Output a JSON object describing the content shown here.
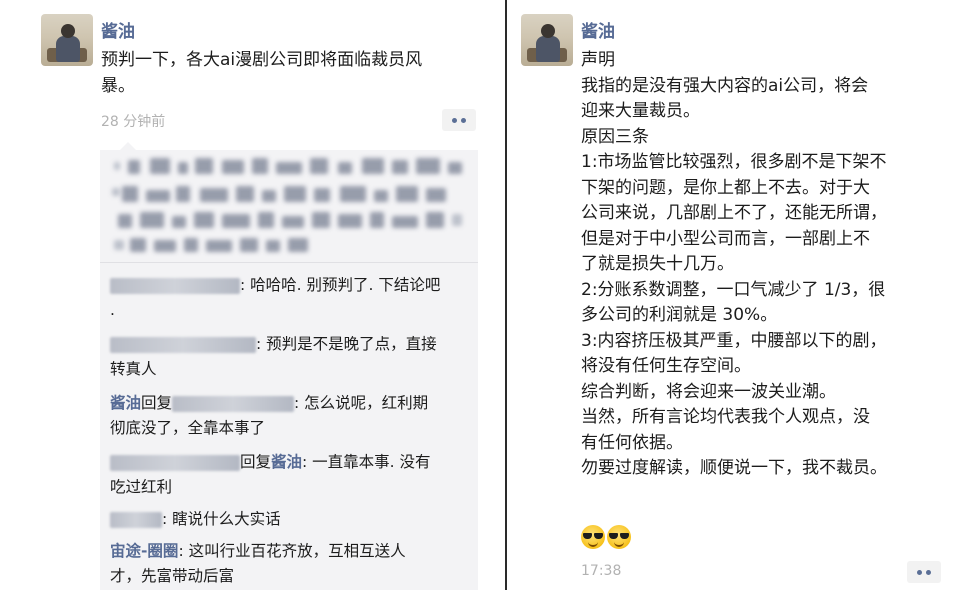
{
  "left_post": {
    "author": "酱油",
    "text_lines": [
      "预判一下，各大ai漫剧公司即将面临裁员风",
      "暴。"
    ],
    "time": "28 分钟前",
    "comments": [
      {
        "reply_to": "",
        "lines": [
          ": 哈哈哈. 别预判了. 下结论吧",
          "."
        ]
      },
      {
        "reply_to": "",
        "lines": [
          ": 预判是不是晚了点，直接",
          "转真人"
        ]
      },
      {
        "author": "酱油",
        "reply_word": "回复",
        "lines": [
          ": 怎么说呢，红利期",
          "彻底没了，全靠本事了"
        ]
      },
      {
        "reply_word": "回复",
        "reply_to": "酱油",
        "lines": [
          ": 一直靠本事. 没有",
          "吃过红利"
        ]
      },
      {
        "lines": [
          ": 瞎说什么大实话"
        ]
      },
      {
        "author": "宙途-圈圈",
        "lines": [
          ": 这叫行业百花齐放，互相互送人",
          "才，先富带动后富"
        ]
      }
    ]
  },
  "right_post": {
    "author": "酱油",
    "text_lines": [
      "声明",
      "我指的是没有强大内容的ai公司，将会",
      "迎来大量裁员。",
      "原因三条",
      "1:市场监管比较强烈，很多剧不是下架不",
      "下架的问题，是你上都上不去。对于大",
      "公司来说，几部剧上不了，还能无所谓，",
      "但是对于中小型公司而言，一部剧上不",
      "了就是损失十几万。",
      "2:分账系数调整，一口气减少了 1/3，很",
      "多公司的利润就是 30%。",
      "3:内容挤压极其严重，中腰部以下的剧，",
      "将没有任何生存空间。",
      "综合判断，将会迎来一波关业潮。",
      "当然，所有言论均代表我个人观点，没",
      "有任何依据。",
      "勿要过度解读，顺便说一下，我不裁员。"
    ],
    "emoji": [
      "sunglasses-emoji",
      "sunglasses-emoji"
    ],
    "time": "17:38"
  },
  "colors": {
    "nickname": "#576b95",
    "time": "#b2b2b2",
    "comment_bg": "#f3f3f5"
  }
}
